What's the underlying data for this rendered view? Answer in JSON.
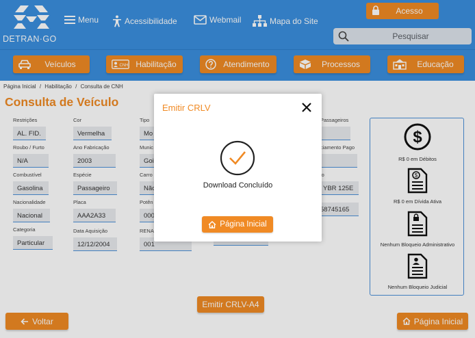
{
  "header": {
    "logo_text": "DETRAN·GO",
    "nav": {
      "menu": "Menu",
      "acessibilidade": "Acessibilidade",
      "webmail": "Webmail",
      "mapa": "Mapa do Site"
    },
    "acesso_label": "Acesso",
    "search_placeholder": "Pesquisar"
  },
  "navbar": {
    "items": [
      {
        "label": "Veículos",
        "icon": "car-icon"
      },
      {
        "label": "Habilitação",
        "icon": "cnh-card-icon"
      },
      {
        "label": "Atendimento",
        "icon": "question-icon"
      },
      {
        "label": "Processos",
        "icon": "box-icon"
      },
      {
        "label": "Educação",
        "icon": "school-icon"
      }
    ]
  },
  "breadcrumb": [
    "Página Inicial",
    "/",
    "Habilitação",
    "/",
    "Consulta de CNH"
  ],
  "page_title": "Consulta de Veículo",
  "fields": {
    "restricoes": {
      "label": "Restrições",
      "value": "AL. FID."
    },
    "roubo": {
      "label": "Roubo / Furto",
      "value": "N/A"
    },
    "combustivel": {
      "label": "Combustível",
      "value": "Gasolina"
    },
    "nacionalidade": {
      "label": "Nacionalidade",
      "value": "Nacional"
    },
    "categoria": {
      "label": "Categoria",
      "value": "Particular"
    },
    "cor": {
      "label": "Cor",
      "value": "Vermelha"
    },
    "ano_fabricacao": {
      "label": "Ano Fabricação",
      "value": "2003"
    },
    "especie": {
      "label": "Espécie",
      "value": "Passageiro"
    },
    "placa": {
      "label": "Placa",
      "value": "AAA2A33"
    },
    "data_aquisicao": {
      "label": "Data Aquisição",
      "value": "12/12/2004"
    },
    "tipo": {
      "label": "Tipo",
      "value": "Mo"
    },
    "municipio": {
      "label": "Munic",
      "value": "Goi"
    },
    "carroceria": {
      "label": "Carro",
      "value": "Não"
    },
    "potencia": {
      "label": "Potên",
      "value": "000"
    },
    "renavam": {
      "label": "RENA",
      "value": "001"
    },
    "passageiros": {
      "label": "Passageiros",
      "value": ""
    },
    "licenciamento": {
      "label": "ciamento Pago",
      "value": ""
    },
    "modelo": {
      "label": "lo",
      "value": "YBR 125E"
    },
    "chassi": {
      "label": "",
      "value": "58745165"
    }
  },
  "status_panel": {
    "items": [
      {
        "label": "R$ 0 em Débitos",
        "icon": "dollar-circle-icon"
      },
      {
        "label": "R$ 0 em Dívida Ativa",
        "icon": "document-dollar-icon"
      },
      {
        "label": "Nenhum Bloqueio Administrativo",
        "icon": "document-lock-icon"
      },
      {
        "label": "Nenhum Bloqueio Judicial",
        "icon": "document-person-icon"
      }
    ]
  },
  "actions": {
    "emitir": "Emitir CRLV-A4",
    "voltar": "Voltar",
    "pagina_inicial": "Página Inicial"
  },
  "modal": {
    "title": "Emitir CRLV",
    "message": "Download Concluído",
    "button": "Página Inicial"
  },
  "colors": {
    "header_blue": "#3b8fde",
    "accent_orange": "#f08a24"
  }
}
